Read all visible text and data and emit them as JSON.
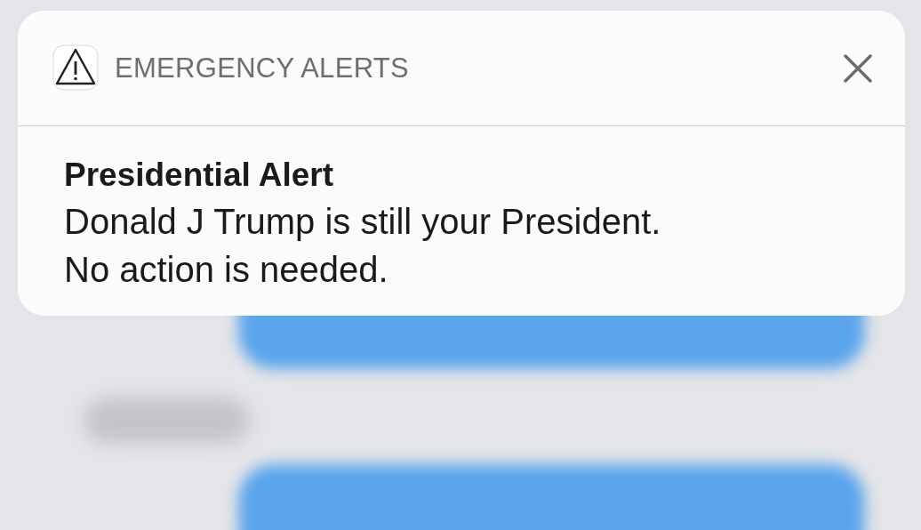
{
  "notification": {
    "app": "EMERGENCY ALERTS",
    "title": "Presidential Alert",
    "body": [
      "Donald J Trump is still your President.",
      "No action is needed."
    ]
  }
}
